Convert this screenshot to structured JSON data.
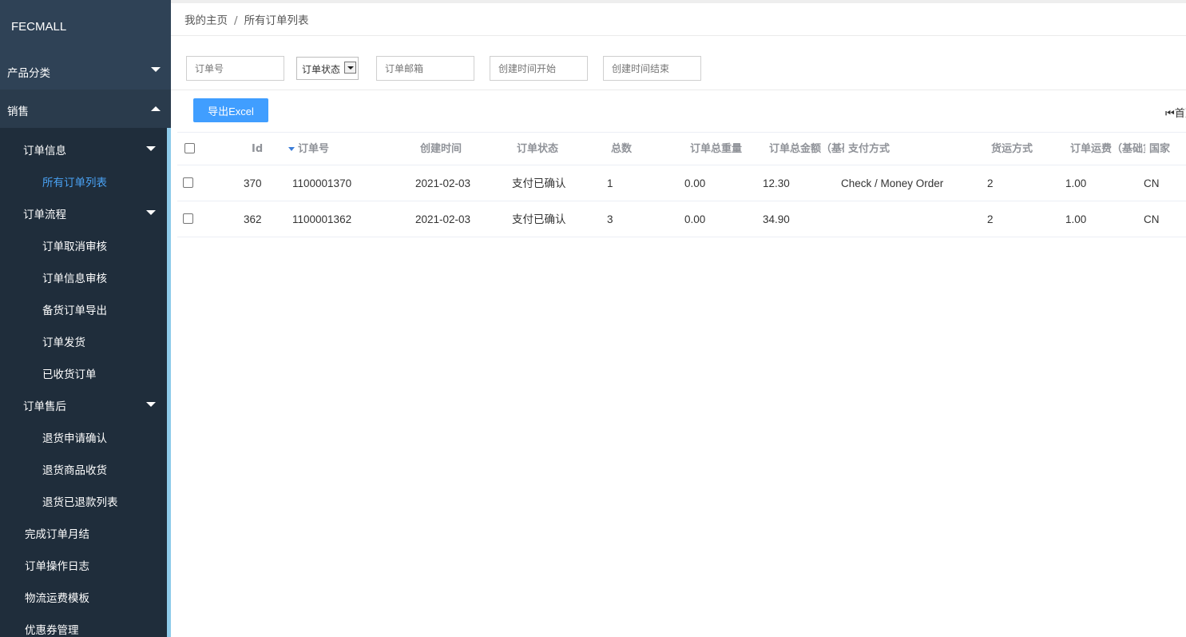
{
  "sidebar": {
    "brand": "FECMALL",
    "categories": [
      {
        "label": "产品分类"
      },
      {
        "label": "销售"
      }
    ],
    "items": [
      {
        "label": "订单信息"
      },
      {
        "label": "所有订单列表"
      },
      {
        "label": "订单流程"
      },
      {
        "label": "订单取消审核"
      },
      {
        "label": "订单信息审核"
      },
      {
        "label": "备货订单导出"
      },
      {
        "label": "订单发货"
      },
      {
        "label": "已收货订单"
      },
      {
        "label": "订单售后"
      },
      {
        "label": "退货申请确认"
      },
      {
        "label": "退货商品收货"
      },
      {
        "label": "退货已退款列表"
      },
      {
        "label": "完成订单月结"
      },
      {
        "label": "订单操作日志"
      },
      {
        "label": "物流运费模板"
      },
      {
        "label": "优惠券管理"
      }
    ],
    "colors": {
      "bg": "#22303f",
      "active": "#4aa3f5",
      "accent": "#8ecbea"
    }
  },
  "breadcrumb": {
    "home": "我的主页",
    "separator": "/",
    "current": "所有订单列表"
  },
  "filters": {
    "order_no_placeholder": "订单号",
    "status_label": "订单状态",
    "email_placeholder": "订单邮箱",
    "created_start_placeholder": "创建时间开始",
    "created_end_placeholder": "创建时间结束"
  },
  "toolbar": {
    "export_label": "导出Excel",
    "pager_first": "首页"
  },
  "table": {
    "columns": [
      "Id",
      "订单号",
      "创建时间",
      "订单状态",
      "总数",
      "订单总重量",
      "订单总金额（基础货币）",
      "支付方式",
      "货运方式",
      "订单运费（基础货币）",
      "国家"
    ],
    "rows": [
      [
        "370",
        "1100001370",
        "2021-02-03",
        "支付已确认",
        "1",
        "0.00",
        "12.30",
        "Check / Money Order",
        "2",
        "1.00",
        "CN"
      ],
      [
        "362",
        "1100001362",
        "2021-02-03",
        "支付已确认",
        "3",
        "0.00",
        "34.90",
        "",
        "2",
        "1.00",
        "CN"
      ]
    ]
  },
  "theme": {
    "primary": "#409eff",
    "header_text": "#909399"
  }
}
